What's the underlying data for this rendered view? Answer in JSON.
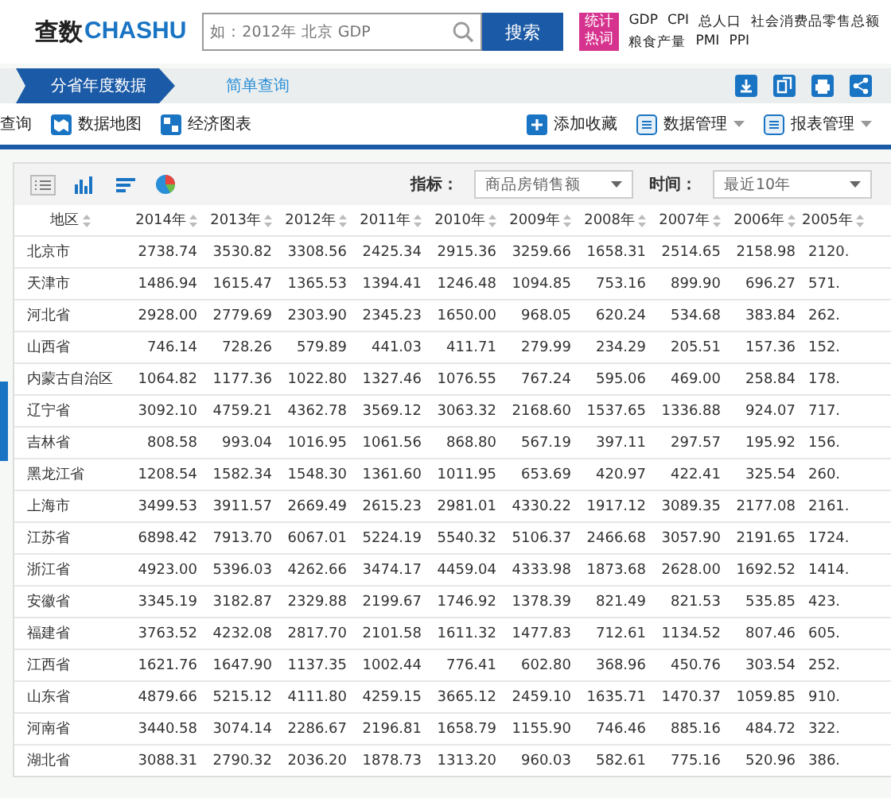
{
  "header": {
    "logo_main": "查数",
    "logo_sub": "CHASHU",
    "search": {
      "placeholder": "如：2012年 北京 GDP"
    },
    "search_button": "搜索",
    "hot_badge": "统计热词",
    "hot_words": [
      "GDP",
      "CPI",
      "总人口",
      "社会消费品零售总额",
      "粮食产量",
      "PMI",
      "PPI"
    ]
  },
  "breadcrumb": [
    {
      "label": "分省年度数据",
      "selected": true
    },
    {
      "label": "简单查询",
      "selected": false
    }
  ],
  "toolbar_left": [
    "查询",
    "数据地图",
    "经济图表"
  ],
  "toolbar_right": [
    {
      "label": "添加收藏",
      "dropdown": false
    },
    {
      "label": "数据管理",
      "dropdown": true
    },
    {
      "label": "报表管理",
      "dropdown": true
    }
  ],
  "filters": [
    {
      "label": "指标：",
      "value": "商品房销售额"
    },
    {
      "label": "时间：",
      "value": "最近10年"
    }
  ],
  "table": {
    "columns": [
      "地区",
      "2014年",
      "2013年",
      "2012年",
      "2011年",
      "2010年",
      "2009年",
      "2008年",
      "2007年",
      "2006年",
      "2005年"
    ],
    "rows": [
      [
        "北京市",
        "2738.74",
        "3530.82",
        "3308.56",
        "2425.34",
        "2915.36",
        "3259.66",
        "1658.31",
        "2514.65",
        "2158.98",
        "2120."
      ],
      [
        "天津市",
        "1486.94",
        "1615.47",
        "1365.53",
        "1394.41",
        "1246.48",
        "1094.85",
        "753.16",
        "899.90",
        "696.27",
        "571."
      ],
      [
        "河北省",
        "2928.00",
        "2779.69",
        "2303.90",
        "2345.23",
        "1650.00",
        "968.05",
        "620.24",
        "534.68",
        "383.84",
        "262."
      ],
      [
        "山西省",
        "746.14",
        "728.26",
        "579.89",
        "441.03",
        "411.71",
        "279.99",
        "234.29",
        "205.51",
        "157.36",
        "152."
      ],
      [
        "内蒙古自治区",
        "1064.82",
        "1177.36",
        "1022.80",
        "1327.46",
        "1076.55",
        "767.24",
        "595.06",
        "469.00",
        "258.84",
        "178."
      ],
      [
        "辽宁省",
        "3092.10",
        "4759.21",
        "4362.78",
        "3569.12",
        "3063.32",
        "2168.60",
        "1537.65",
        "1336.88",
        "924.07",
        "717."
      ],
      [
        "吉林省",
        "808.58",
        "993.04",
        "1016.95",
        "1061.56",
        "868.80",
        "567.19",
        "397.11",
        "297.57",
        "195.92",
        "156."
      ],
      [
        "黑龙江省",
        "1208.54",
        "1582.34",
        "1548.30",
        "1361.60",
        "1011.95",
        "653.69",
        "420.97",
        "422.41",
        "325.54",
        "260."
      ],
      [
        "上海市",
        "3499.53",
        "3911.57",
        "2669.49",
        "2615.23",
        "2981.01",
        "4330.22",
        "1917.12",
        "3089.35",
        "2177.08",
        "2161."
      ],
      [
        "江苏省",
        "6898.42",
        "7913.70",
        "6067.01",
        "5224.19",
        "5540.32",
        "5106.37",
        "2466.68",
        "3057.90",
        "2191.65",
        "1724."
      ],
      [
        "浙江省",
        "4923.00",
        "5396.03",
        "4262.66",
        "3474.17",
        "4459.04",
        "4333.98",
        "1873.68",
        "2628.00",
        "1692.52",
        "1414."
      ],
      [
        "安徽省",
        "3345.19",
        "3182.87",
        "2329.88",
        "2199.67",
        "1746.92",
        "1378.39",
        "821.49",
        "821.53",
        "535.85",
        "423."
      ],
      [
        "福建省",
        "3763.52",
        "4232.08",
        "2817.70",
        "2101.58",
        "1611.32",
        "1477.83",
        "712.61",
        "1134.52",
        "807.46",
        "605."
      ],
      [
        "江西省",
        "1621.76",
        "1647.90",
        "1137.35",
        "1002.44",
        "776.41",
        "602.80",
        "368.96",
        "450.76",
        "303.54",
        "252."
      ],
      [
        "山东省",
        "4879.66",
        "5215.12",
        "4111.80",
        "4259.15",
        "3665.12",
        "2459.10",
        "1635.71",
        "1470.37",
        "1059.85",
        "910."
      ],
      [
        "河南省",
        "3440.58",
        "3074.14",
        "2286.67",
        "2196.81",
        "1658.79",
        "1155.90",
        "746.46",
        "885.16",
        "484.72",
        "322."
      ],
      [
        "湖北省",
        "3088.31",
        "2790.32",
        "2036.20",
        "1878.73",
        "1313.20",
        "960.03",
        "582.61",
        "775.16",
        "520.96",
        "386."
      ]
    ]
  }
}
